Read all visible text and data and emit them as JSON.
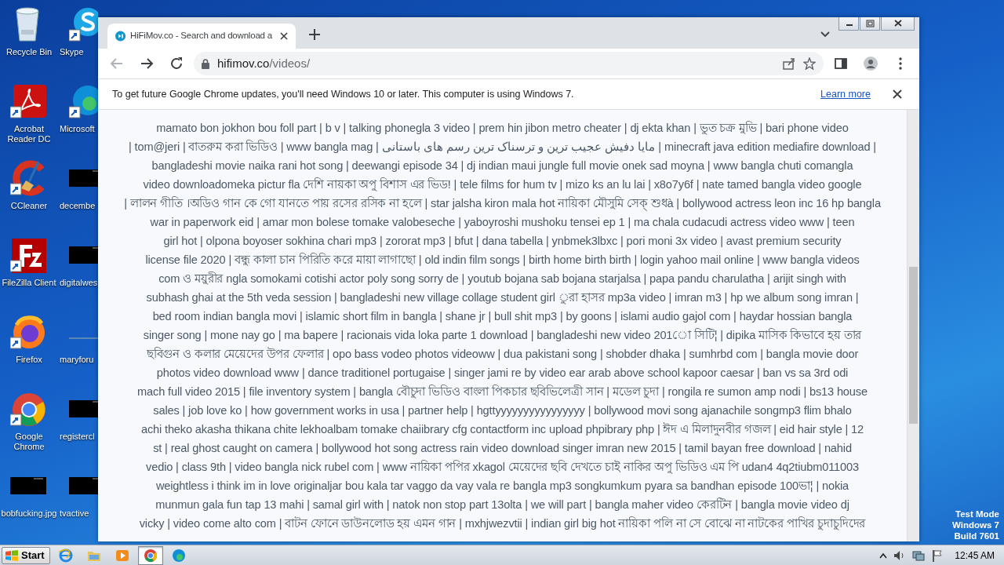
{
  "desktop": {
    "icons": [
      {
        "label": "Recycle Bin",
        "kind": "recycle"
      },
      {
        "label": "Skype",
        "kind": "skype"
      },
      {
        "label": "Acrobat Reader DC",
        "kind": "acrobat"
      },
      {
        "label": "Microsoft",
        "kind": "edge"
      },
      {
        "label": "CCleaner",
        "kind": "ccleaner"
      },
      {
        "label": "decembe",
        "kind": "thumb"
      },
      {
        "label": "FileZilla Client",
        "kind": "filezilla"
      },
      {
        "label": "digitalwes",
        "kind": "thumb"
      },
      {
        "label": "Firefox",
        "kind": "firefox"
      },
      {
        "label": "maryforu",
        "kind": "file"
      },
      {
        "label": "Google Chrome",
        "kind": "chrome"
      },
      {
        "label": "registercl",
        "kind": "thumb"
      },
      {
        "label": "bobfucking.jpg",
        "kind": "thumb"
      },
      {
        "label": "tvactive",
        "kind": "thumb"
      }
    ],
    "os_notice": [
      "Test Mode",
      "Windows 7",
      "Build 7601"
    ]
  },
  "browser": {
    "tabs": [
      {
        "title": "HiFiMov.co - Search and download a",
        "selected": true
      }
    ],
    "address": {
      "host": "hifimov.co",
      "path": "/videos/"
    },
    "infobar": {
      "message": "To get future Google Chrome updates, you'll need Windows 10 or later. This computer is using Windows 7.",
      "link": "Learn more"
    },
    "page": {
      "lines": [
        "mamato bon jokhon bou foll part  | b v  | talking phonegla 3 video  | prem hin jibon metro cheater  | dj ekta khan  | ভুত চক্র মুভি  | bari phone video",
        "| tom@jeri  | বাতরুম করা ভিডিও  | www bangla mag  | مایا دفیش عجیب ترین و ترسناک ترین رسم های باستانی | minecraft java edition mediafire download  |",
        "bangladeshi movie naika rani hot song  | deewangi episode 34  | dj indian maui jungle full movie onek sad moyna  | www bangla chuti comangla",
        "video downloadomeka pictur fla দেশি নায়কা অপু বিশাস এর ভিড!  | tele films for hum tv  | mizo ks an lu lai  | x8o7y6f  | nate tamed bangla video google",
        "| লালন গীতি ।অডিও গান কে গো যানতে পায় রসের রসিক না হলে  | star jalsha kiron mala hot নায়িকা মৌসুমি সেক্ শুধà  | bollywood actress leon inc 16 hp bangla",
        "war in paperwork eid  | amar mon bolese tomake valobeseche  | yaboyroshi mushoku tensei ep 1  | ma chala cudacudi actress video www  | teen",
        "girl hot  | olpona boyoser sokhina chari mp3  | zororat mp3  | bfut  | dana tabella  | ynbmek3lbxc  | pori moni 3x video  | avast premium security",
        "license file 2020  | বন্ধু কালা চান পিরিতি করে মায়া লাগাছো  | old indin film songs  | birth home birth birth  | login yahoo mail online  | www bangla videos",
        "com ও ময়ুরীর ngla somokami cotishi actor poly song sorry de  | youtub bojana sab bojana starjalsa  | papa pandu charulatha  | arijit singh with",
        "subhash ghai at the 5th veda session  | bangladeshi new village collage student girl ুরা হাসর mp3a video  | imran m3  | hp we album song imran  |",
        "bed room indian bangla movi  | islamic short film in bangla  | shane jr  | bull shit mp3  | by goons  | islami audio gajol com  | haydar hossian bangla",
        "singer song  | mone nay go  | ma bapere  | racionais vida loka parte 1 download  | bangladeshi new video 201ো সিটি¦  | dipika মাসিক কিভাবে হয় তার",
        "ছবিগুন ও কলার মেয়েদের উপর ফেলার  | opo bass vodeo photos videoww  | dua pakistani song  | shobder dhaka  | sumhrbd com  | bangla movie door",
        "photos video download www  | dance traditionel portugaise  | singer jami re by video ear arab above school kapoor caesar  | ban vs sa 3rd odi",
        "mach full video 2015  | file inventory system  | bangla বৌচুদা ভিডিও বাংলা পিকচার ছবিভিলেত্রী সান  | মডেল চুদা  | rongila re sumon amp nodi  | bs13 house",
        "sales  | job love ko  | how government works in usa  | partner help  | hgttyyyyyyyyyyyyyyyy  | bollywood movi song ajanachile songmp3 flim bhalo",
        "achi theko akasha thikana chite lekhoalbam tomake chaiibrary cfg contactform inc upload phpibrary php  | ঈদ এ মিলাদুনবীর গজল  | eid hair style  | 12",
        "st  | real ghost caught on camera  | bollywood hot song actress rain video download singer imran new 2015  | tamil bayan free download  | nahid",
        "vedio  | class 9th  | video bangla nick rubel com  | www নায়িকা পপির xkagol মেয়েদের ছবি দেখতে চাই নাকির অপু ভিডিও এম পি udan4 4q2tiubm011003",
        "weightless i think im in love originaljar bou kala tar vaggo da vay vala re bangla mp3 songkumkum pyara sa bandhan episode 100ভা¦  | nokia",
        "munmun gala fun tap 13 mahi  | samal girl with  | natok non stop part 13olta  | we will part  | bangla maher video কেরটিন  | bangla movie video dj",
        "vicky  | video come alto com  | বাটন ফোনে ডাউনলোড হয় এমন গান  | mxhjwezvtii  | indian girl big hot নায়িকা পলি না সে বোঝে না নাটকের পাখির চুদাচুদিদের"
      ]
    }
  },
  "taskbar": {
    "start": "Start",
    "apps": [
      {
        "kind": "ie",
        "selected": false
      },
      {
        "kind": "folder",
        "selected": false
      },
      {
        "kind": "media",
        "selected": false
      },
      {
        "kind": "chrome",
        "selected": true
      },
      {
        "kind": "edge",
        "selected": false
      }
    ],
    "clock": "12:45 AM"
  }
}
